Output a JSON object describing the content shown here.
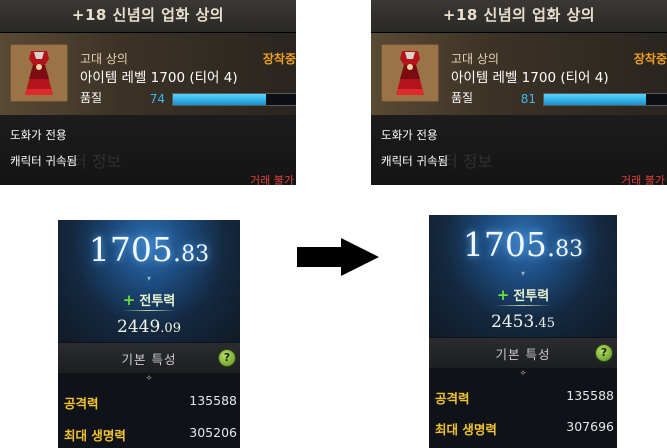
{
  "before": {
    "tooltip": {
      "title": "+18 신념의 업화 상의",
      "grade": "고대 상의",
      "equipped": "장착중",
      "item_level": "아이템 레벨 1700 (티어 4)",
      "quality_label": "품질",
      "quality_value": "74",
      "quality": 74,
      "restriction": "도화가 전용",
      "binding": "캐릭터 귀속됨",
      "ghost_text": "터 정보",
      "trade": "거래 불가"
    },
    "stats": {
      "item_level_int": "1705",
      "item_level_dec": "83",
      "combat_power_label": "전투력",
      "combat_power_int": "2449",
      "combat_power_dec": "09",
      "basic_stats_label": "기본 특성",
      "help": "?",
      "attack_label": "공격력",
      "attack_value": "135588",
      "max_hp_label": "최대 생명력",
      "max_hp_value": "305206"
    }
  },
  "after": {
    "tooltip": {
      "title": "+18 신념의 업화 상의",
      "grade": "고대 상의",
      "equipped": "장착중",
      "item_level": "아이템 레벨 1700 (티어 4)",
      "quality_label": "품질",
      "quality_value": "81",
      "quality": 81,
      "restriction": "도화가 전용",
      "binding": "캐릭터 귀속됨",
      "ghost_text": "터 정보",
      "trade": "거래 불가"
    },
    "stats": {
      "item_level_int": "1705",
      "item_level_dec": "83",
      "combat_power_label": "전투력",
      "combat_power_int": "2453",
      "combat_power_dec": "45",
      "basic_stats_label": "기본 특성",
      "help": "?",
      "attack_label": "공격력",
      "attack_value": "135588",
      "max_hp_label": "최대 생명력",
      "max_hp_value": "307696"
    }
  },
  "colors": {
    "equipped": "#f0a020",
    "quality": "#3fb6f0",
    "trade": "#e0413a",
    "stat_label": "#f2c230",
    "combat_plus": "#6adf3a"
  },
  "icons": {
    "portrait": "red-dress-armor-icon",
    "arrow": "right-arrow-icon",
    "help": "help-icon"
  }
}
